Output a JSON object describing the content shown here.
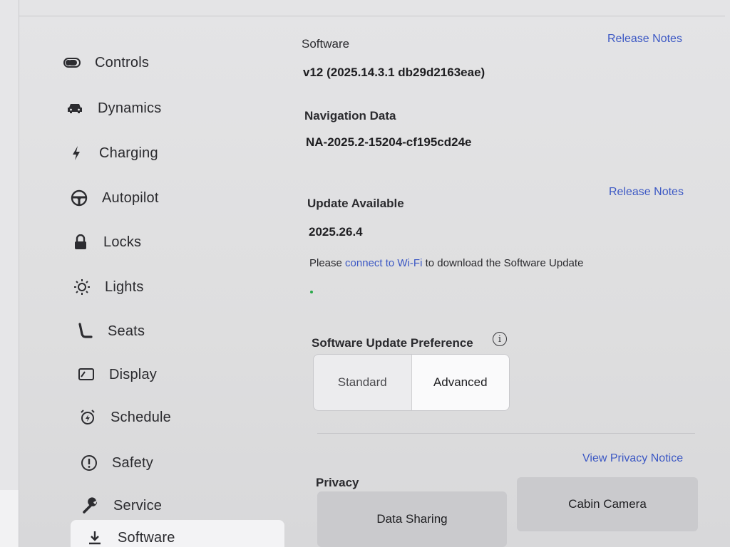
{
  "sidebar": {
    "items": [
      {
        "label": "Controls",
        "icon": "toggle-icon"
      },
      {
        "label": "Dynamics",
        "icon": "car-icon"
      },
      {
        "label": "Charging",
        "icon": "bolt-icon"
      },
      {
        "label": "Autopilot",
        "icon": "steering-wheel-icon"
      },
      {
        "label": "Locks",
        "icon": "lock-icon"
      },
      {
        "label": "Lights",
        "icon": "sun-icon"
      },
      {
        "label": "Seats",
        "icon": "seat-icon"
      },
      {
        "label": "Display",
        "icon": "display-icon"
      },
      {
        "label": "Schedule",
        "icon": "alarm-clock-icon"
      },
      {
        "label": "Safety",
        "icon": "exclamation-circle-icon"
      },
      {
        "label": "Service",
        "icon": "wrench-icon"
      },
      {
        "label": "Software",
        "icon": "download-icon",
        "active": true
      }
    ]
  },
  "software": {
    "heading": "Software",
    "release_notes_label": "Release Notes",
    "version": "v12 (2025.14.3.1 db29d2163eae)"
  },
  "navigation": {
    "heading": "Navigation Data",
    "value": "NA-2025.2-15204-cf195cd24e"
  },
  "update": {
    "heading": "Update Available",
    "release_notes_label": "Release Notes",
    "version": "2025.26.4",
    "message_prefix": "Please",
    "message_link": "connect to Wi-Fi",
    "message_suffix": "to download the Software Update",
    "progress": 0.01,
    "progress_color": "#2aa84a"
  },
  "preference": {
    "heading": "Software Update Preference",
    "info_glyph": "i",
    "options": [
      "Standard",
      "Advanced"
    ],
    "selected": "Advanced"
  },
  "privacy": {
    "heading": "Privacy",
    "notice_link": "View Privacy Notice",
    "buttons": [
      "Data Sharing",
      "Cabin Camera"
    ]
  },
  "colors": {
    "accent_link": "#3c58c4",
    "active_item_bg": "#f3f3f5"
  }
}
